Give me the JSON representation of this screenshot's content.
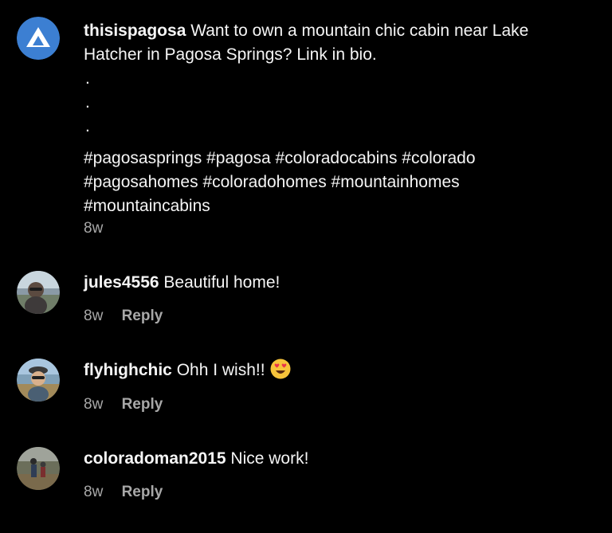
{
  "caption": {
    "username": "thisispagosa",
    "text_line1": " Want to own a mountain chic cabin near Lake",
    "text_line2": "Hatcher in Pagosa Springs? Link in bio.",
    "dots": [
      ".",
      ".",
      "."
    ],
    "hashtags_line1": "#pagosasprings #pagosa #coloradocabins #colorado",
    "hashtags_line2": "#pagosahomes #coloradohomes #mountainhomes",
    "hashtags_line3": "#mountaincabins",
    "time": "8w",
    "avatar_icon": "mountain-logo-icon",
    "avatar_color": "#3c7fd2"
  },
  "comments": [
    {
      "username": "jules4556",
      "text": " Beautiful home!",
      "time": "8w",
      "reply_label": "Reply"
    },
    {
      "username": "flyhighchic",
      "text": " Ohh I wish!!",
      "emoji": "heart-eyes-emoji-icon",
      "time": "8w",
      "reply_label": "Reply"
    },
    {
      "username": "coloradoman2015",
      "text": " Nice work!",
      "time": "8w",
      "reply_label": "Reply"
    }
  ],
  "colors": {
    "background": "#000000",
    "text": "#f5f5f5",
    "meta": "#a8a8a8",
    "emoji_face": "#f7c33a",
    "emoji_heart": "#e8334a"
  }
}
